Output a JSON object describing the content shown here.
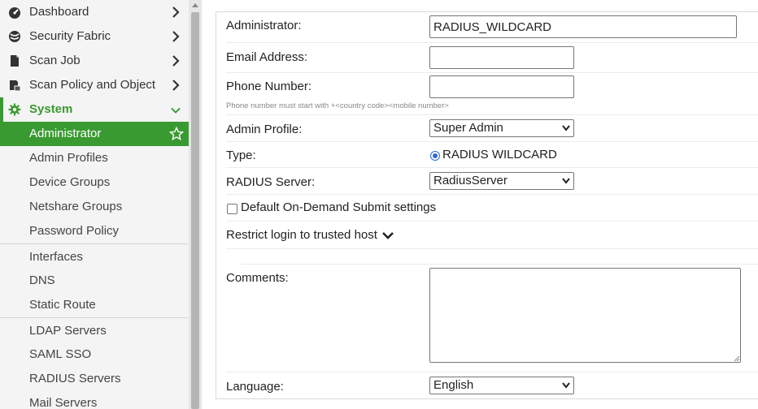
{
  "sidebar": {
    "top_items": [
      {
        "label": "Dashboard",
        "icon": "dashboard-icon"
      },
      {
        "label": "Security Fabric",
        "icon": "security-fabric-icon"
      },
      {
        "label": "Scan Job",
        "icon": "document-icon"
      },
      {
        "label": "Scan Policy and Object",
        "icon": "policy-icon"
      }
    ],
    "system": {
      "label": "System",
      "icon": "gear-icon"
    },
    "sub_items": [
      {
        "label": "Administrator"
      },
      {
        "label": "Admin Profiles"
      },
      {
        "label": "Device Groups"
      },
      {
        "label": "Netshare Groups"
      },
      {
        "label": "Password Policy"
      },
      {
        "label": "Interfaces"
      },
      {
        "label": "DNS"
      },
      {
        "label": "Static Route"
      },
      {
        "label": "LDAP Servers"
      },
      {
        "label": "SAML SSO"
      },
      {
        "label": "RADIUS Servers"
      },
      {
        "label": "Mail Servers"
      }
    ]
  },
  "form": {
    "administrator_label": "Administrator:",
    "administrator_value": "RADIUS_WILDCARD",
    "email_label": "Email Address:",
    "email_value": "",
    "phone_label": "Phone Number:",
    "phone_value": "",
    "phone_hint": "Phone number must start with +<country code><mobile number>",
    "profile_label": "Admin Profile:",
    "profile_value": "Super Admin",
    "type_label": "Type:",
    "type_value": "RADIUS WILDCARD",
    "radius_label": "RADIUS Server:",
    "radius_value": "RadiusServer",
    "ondemand_label": "Default On-Demand Submit settings",
    "restrict_label": "Restrict login to trusted host",
    "comments_label": "Comments:",
    "comments_value": "",
    "language_label": "Language:",
    "language_value": "English"
  },
  "colors": {
    "accent": "#3a9a32",
    "radio": "#2a6ad8"
  }
}
